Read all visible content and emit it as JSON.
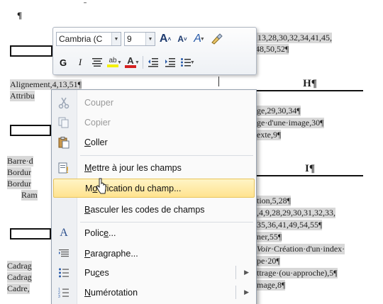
{
  "document": {
    "pilcrow": "¶",
    "lines": {
      "right1": ",13,28,30,32,34,41,45,",
      "right2": "48,50,52¶",
      "alignement": "Alignement,4,13,51¶",
      "attribu": "Attribu",
      "heading_h": "H¶",
      "right_ge": "ge,29,30,34¶",
      "right_image": "ge·d'une·image,30¶",
      "right_texte": "exte,9¶",
      "barre": "Barre·d",
      "bordur1": "Bordur",
      "bordur2": "Bordur",
      "ram": "Ram",
      "heading_i": "I¶",
      "right_tion": "tion,5,28¶",
      "right_49": ",4,9,28,29,30,31,32,33,",
      "right_35": "35,36,41,49,54,55¶",
      "right_ner": "ner,55¶",
      "right_voir_italic": "Voir",
      "right_voir_rest": "·Création·d'un·index·",
      "right_pe": "pe·20¶",
      "right_ttrage": "ttrage·(ou·approche),5¶",
      "right_mage": "mage,8¶",
      "cadrag1": "Cadrag",
      "cadrag2": "Cadrag",
      "cadre": "Cadre,"
    }
  },
  "mini_toolbar": {
    "font_name": "Cambria (C",
    "font_size": "9",
    "grow_font": "A",
    "shrink_font": "A",
    "styles": "A",
    "bold": "G",
    "italic": "I",
    "font_color_letter": "A",
    "highlight_letters": "ab"
  },
  "context_menu": {
    "items": [
      {
        "label": "Couper",
        "icon": "scissors-icon",
        "disabled": true
      },
      {
        "label": "Copier",
        "icon": "copy-icon",
        "disabled": true
      },
      {
        "label": "Coller",
        "icon": "paste-icon",
        "disabled": false
      },
      {
        "label": "Mettre à jour les champs",
        "icon": "update-fields-icon",
        "disabled": false
      },
      {
        "label": "Modification du champ...",
        "icon": "none",
        "disabled": false,
        "hovered": true
      },
      {
        "label": "Basculer les codes de champs",
        "icon": "none",
        "disabled": false
      },
      {
        "label": "Police...",
        "icon": "font-icon",
        "disabled": false
      },
      {
        "label": "Paragraphe...",
        "icon": "paragraph-icon",
        "disabled": false
      },
      {
        "label": "Puces",
        "icon": "bullets-icon",
        "disabled": false,
        "submenu": true
      },
      {
        "label": "Numérotation",
        "icon": "numbering-icon",
        "disabled": false,
        "submenu": true
      }
    ]
  },
  "colors": {
    "menu_hover": "#ffe38f",
    "font_color_red": "#d42020",
    "highlight_yellow": "#f4f000"
  }
}
